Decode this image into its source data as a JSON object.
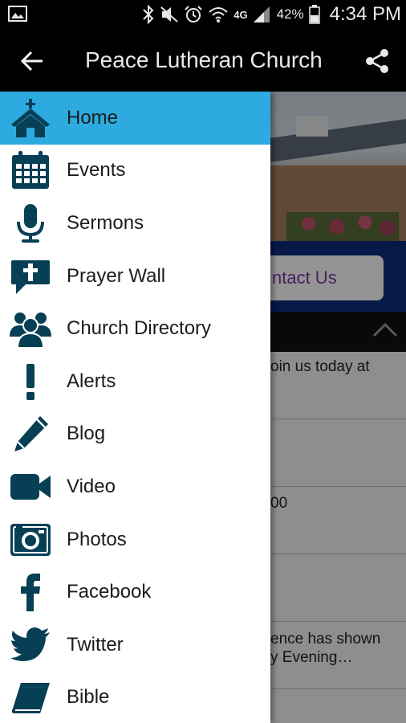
{
  "status_bar": {
    "battery_percent": "42%",
    "time": "4:34 PM",
    "network": "4G",
    "icons": [
      "gallery-icon",
      "bluetooth-icon",
      "mute-icon",
      "alarm-icon",
      "wifi-icon",
      "network-4g-icon",
      "signal-icon",
      "battery-icon"
    ]
  },
  "app_bar": {
    "title": "Peace Lutheran Church",
    "back_icon": "back-arrow-icon",
    "share_icon": "share-icon"
  },
  "drawer": {
    "active_color": "#2dabe0",
    "icon_color": "#073f55",
    "items": [
      {
        "label": "Home",
        "icon": "church-icon",
        "active": true
      },
      {
        "label": "Events",
        "icon": "calendar-icon",
        "active": false
      },
      {
        "label": "Sermons",
        "icon": "microphone-icon",
        "active": false
      },
      {
        "label": "Prayer Wall",
        "icon": "cross-speech-bubble-icon",
        "active": false
      },
      {
        "label": "Church Directory",
        "icon": "people-group-icon",
        "active": false
      },
      {
        "label": "Alerts",
        "icon": "exclamation-icon",
        "active": false
      },
      {
        "label": "Blog",
        "icon": "pencil-icon",
        "active": false
      },
      {
        "label": "Video",
        "icon": "video-camera-icon",
        "active": false
      },
      {
        "label": "Photos",
        "icon": "camera-icon",
        "active": false
      },
      {
        "label": "Facebook",
        "icon": "facebook-icon",
        "active": false
      },
      {
        "label": "Twitter",
        "icon": "twitter-icon",
        "active": false
      },
      {
        "label": "Bible",
        "icon": "bible-icon",
        "active": false
      }
    ]
  },
  "background": {
    "contact_button": "ntact Us",
    "list_items": [
      "oin us today at",
      "",
      "00",
      "",
      "ence has shown\ny Evening…",
      ""
    ]
  }
}
